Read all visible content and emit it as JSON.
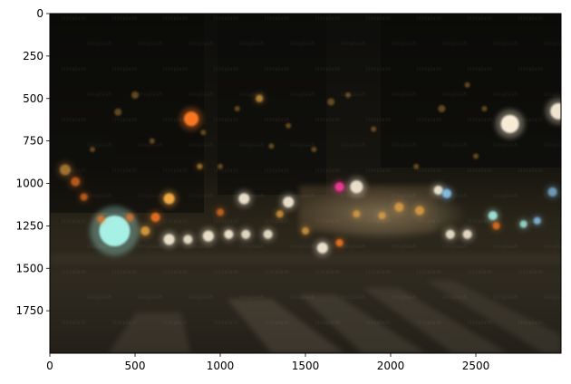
{
  "image": {
    "description_tags": [
      "night",
      "city-street",
      "bokeh",
      "blurred-lights"
    ],
    "watermark_text": "Unsplash",
    "palette": {
      "sky": "#0f0f0c",
      "street": "#2a2620",
      "road_light": "#4a4539",
      "warm_light": "#ffb347",
      "orange_light": "#ff7a20",
      "white_light": "#fff4de",
      "blue_light": "#8fd1ff",
      "cyan_light": "#b0fff4",
      "pink_light": "#ff3aa0",
      "frame": "#000000"
    }
  },
  "axes": {
    "x_ticks": [
      "0",
      "500",
      "1000",
      "1500",
      "2000",
      "2500"
    ],
    "y_ticks": [
      "0",
      "250",
      "500",
      "750",
      "1000",
      "1250",
      "1500",
      "1750"
    ],
    "xlim": [
      0,
      3000
    ],
    "ylim": [
      2000,
      0
    ]
  }
}
